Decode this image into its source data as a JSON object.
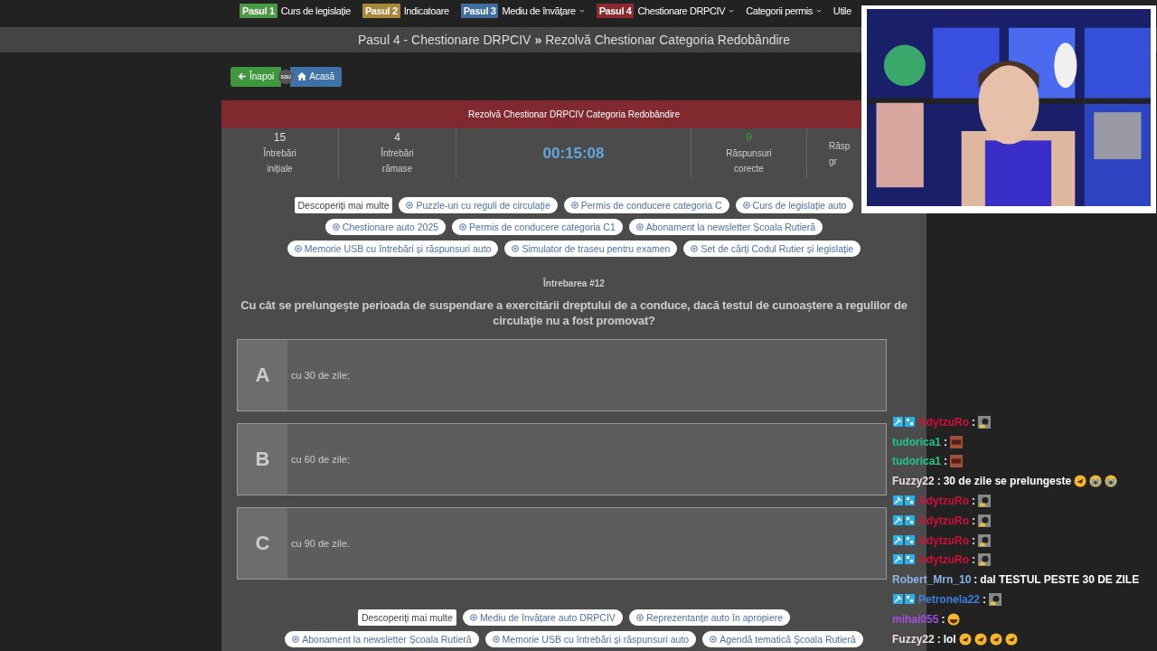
{
  "nav": [
    {
      "step": "Pasul 1",
      "color": "#4a9a45",
      "label": "Curs de legislație",
      "dropdown": false
    },
    {
      "step": "Pasul 2",
      "color": "#a8863a",
      "label": "Indicatoare",
      "dropdown": false
    },
    {
      "step": "Pasul 3",
      "color": "#3e6fa0",
      "label": "Mediu de învățare",
      "dropdown": true
    },
    {
      "step": "Pasul 4",
      "color": "#8b2a30",
      "label": "Chestionare DRPCIV",
      "dropdown": true
    },
    {
      "label": "Categorii permis",
      "dropdown": true
    },
    {
      "label": "Utile",
      "dropdown": false
    }
  ],
  "breadcrumb": {
    "parent": "Pasul 4 - Chestionare DRPCIV",
    "separator": "»",
    "current": "Rezolvă Chestionar Categoria Redobândire"
  },
  "back_button": "Înapoi",
  "or_label": "sau",
  "home_button": "Acasă",
  "quiz_title": "Rezolvă Chestionar DRPCIV Categoria Redobândire",
  "stats": [
    {
      "kind": "count",
      "value": "15",
      "label": [
        "Întrebări",
        "inițiale"
      ]
    },
    {
      "kind": "count",
      "value": "4",
      "label": [
        "Întrebări",
        "rămase"
      ]
    },
    {
      "kind": "timer",
      "value": "00:15:08"
    },
    {
      "kind": "good",
      "value": "9",
      "label": [
        "Răspunsuri",
        "corecte"
      ]
    },
    {
      "kind": "cut",
      "label": [
        "Răsp",
        "gr"
      ]
    }
  ],
  "tags_top": {
    "heading": "Descoperiți mai multe",
    "items": [
      "Puzzle-uri cu reguli de circulație",
      "Permis de conducere categoria C",
      "Curs de legislație auto",
      "Chestionare auto 2025",
      "Permis de conducere categoria C1",
      "Abonament la newsletter Școala Rutieră",
      "Memorie USB cu întrebări și răspunsuri auto",
      "Simulator de traseu pentru examen",
      "Set de cărți Codul Rutier și legislație"
    ]
  },
  "question_number": "Întrebarea #12",
  "question": "Cu cât se prelungește perioada de suspendare a exercitării dreptului de a conduce, dacă testul de cunoaștere a regulilor de circulaţie nu a fost promovat?",
  "answers": [
    {
      "letter": "A",
      "text": "cu 30 de zile;",
      "selected": false
    },
    {
      "letter": "B",
      "text": "cu 60 de zile;",
      "selected": false
    },
    {
      "letter": "C",
      "text": "cu 90 de zile.",
      "selected": false
    }
  ],
  "tags_bottom": {
    "heading": "Descoperiți mai multe",
    "items": [
      "Mediu de învățare auto DRPCIV",
      "Reprezentanțe auto în apropiere",
      "Abonament la newsletter Școala Rutieră",
      "Memorie USB cu întrebări și răspunsuri auto",
      "Agendă tematică Școala Rutieră"
    ]
  },
  "chat": {
    "separator": ":",
    "messages": [
      {
        "user": "AdytzuRo",
        "color": "#d0103a",
        "badges": true,
        "emotes": [
          {
            "kind": "sticker"
          }
        ]
      },
      {
        "user": "tudorica1",
        "color": "#1fc88a",
        "badges": false,
        "emotes": [
          {
            "kind": "face"
          }
        ]
      },
      {
        "user": "tudorica1",
        "color": "#1fc88a",
        "badges": false,
        "emotes": [
          {
            "kind": "face"
          }
        ]
      },
      {
        "user": "Fuzzy22",
        "color": "#f0dede",
        "badges": false,
        "text": "30 de zile se prelungeste",
        "emotes": [
          {
            "kind": "rofl"
          },
          {
            "kind": "cry"
          },
          {
            "kind": "cry"
          }
        ]
      },
      {
        "user": "AdytzuRo",
        "color": "#d0103a",
        "badges": true,
        "emotes": [
          {
            "kind": "sticker"
          }
        ]
      },
      {
        "user": "AdytzuRo",
        "color": "#d0103a",
        "badges": true,
        "emotes": [
          {
            "kind": "sticker"
          }
        ]
      },
      {
        "user": "AdytzuRo",
        "color": "#d0103a",
        "badges": true,
        "emotes": [
          {
            "kind": "sticker"
          }
        ]
      },
      {
        "user": "AdytzuRo",
        "color": "#d0103a",
        "badges": true,
        "emotes": [
          {
            "kind": "sticker"
          }
        ]
      },
      {
        "user": "Robert_Mrn_10",
        "color": "#8ab4e8",
        "badges": false,
        "text": "dal TESTUL PESTE 30 DE ZILE"
      },
      {
        "user": "Petronela22",
        "color": "#3d7fe0",
        "badges": true,
        "emotes": [
          {
            "kind": "sticker"
          }
        ]
      },
      {
        "user": "mihai055",
        "color": "#a64ee0",
        "badges": false,
        "emotes": [
          {
            "kind": "laugh"
          }
        ]
      },
      {
        "user": "Fuzzy22",
        "color": "#f0dede",
        "badges": false,
        "text": "lol",
        "emotes": [
          {
            "kind": "rofl"
          },
          {
            "kind": "rofl"
          },
          {
            "kind": "rofl"
          },
          {
            "kind": "rofl"
          }
        ]
      }
    ]
  }
}
